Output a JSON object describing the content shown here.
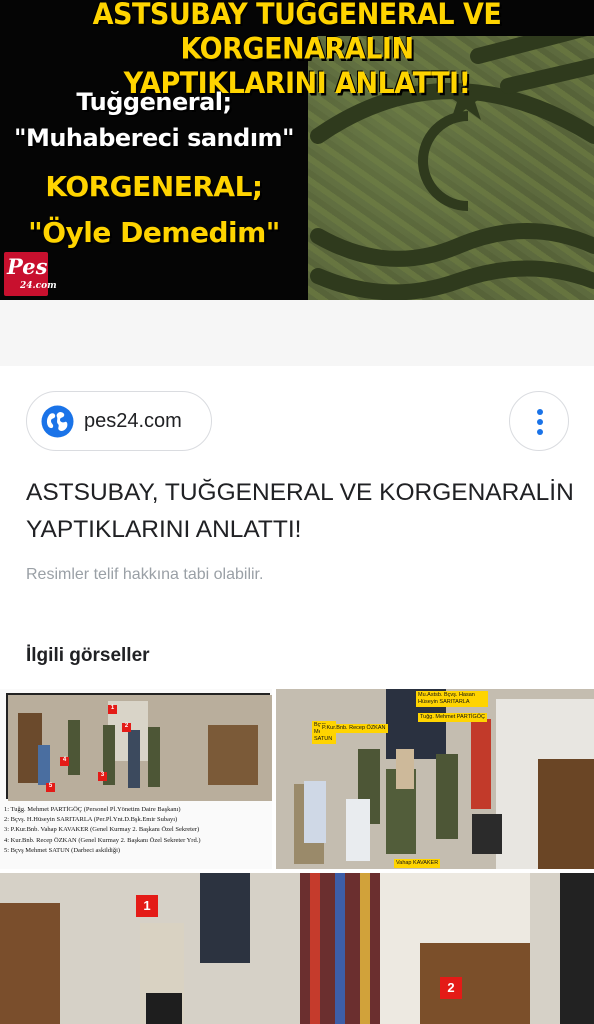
{
  "hero": {
    "headline_line1": "ASTSUBAY TUĞGENERAL VE  KORGENARALIN",
    "headline_line2": "YAPTIKLARINI ANLATTI!",
    "quote1_speaker": "Tuğgeneral;",
    "quote1_text": "\"Muhabereci sandım\"",
    "quote2_speaker": "KORGENERAL;",
    "quote2_text": "\"Öyle Demedim\"",
    "logo_big": "Pes",
    "logo_small": "24.com",
    "accent_yellow": "#ffd400",
    "logo_red": "#c8102e"
  },
  "result": {
    "source_icon": "globe-icon",
    "source_domain": "pes24.com",
    "more_icon": "more-vertical-icon",
    "title": "ASTSUBAY, TUĞGENERAL VE KORGENARALİN YAPTIKLARINI ANLATTI!",
    "copyright_note": "Resimler telif hakkına tabi olabilir.",
    "link_color": "#1a73e8"
  },
  "related": {
    "heading": "İlgili görseller",
    "thumb1": {
      "markers": [
        "1",
        "2",
        "3",
        "4",
        "5"
      ],
      "caption_lines": [
        "1: Tuğg. Mehmet PARTİGÖÇ (Personel Pl.Yönetim Daire Başkanı)",
        "2: Bçvş. H.Hüseyin SARITARLA (Per.Pl.Ynt.D.Bşk.Emir Subayı)",
        "3: P.Kur.Bnb. Vahap KAVAKER (Genel Kurmay 2. Başkanı Özel Sekreter)",
        "4: Kur.Bnb. Recep ÖZKAN (Genel Kurmay 2. Başkanı Özel Sekreter Yrd.)",
        "5: Bçvş Mehmet SATUN (Darbeci askildiği)"
      ]
    },
    "thumb2": {
      "tags": [
        "Bçvş. Mehmet SATUN",
        "P.Kur.Bnb. Recep ÖZKAN",
        "Mu.Astsb. Bçvş. Hasan Hüseyin SARITARLA",
        "Tuğg. Mehmet PARTİGÖÇ",
        "Vahap KAVAKER"
      ]
    },
    "thumb3": {
      "markers": [
        "1",
        "2"
      ]
    }
  }
}
